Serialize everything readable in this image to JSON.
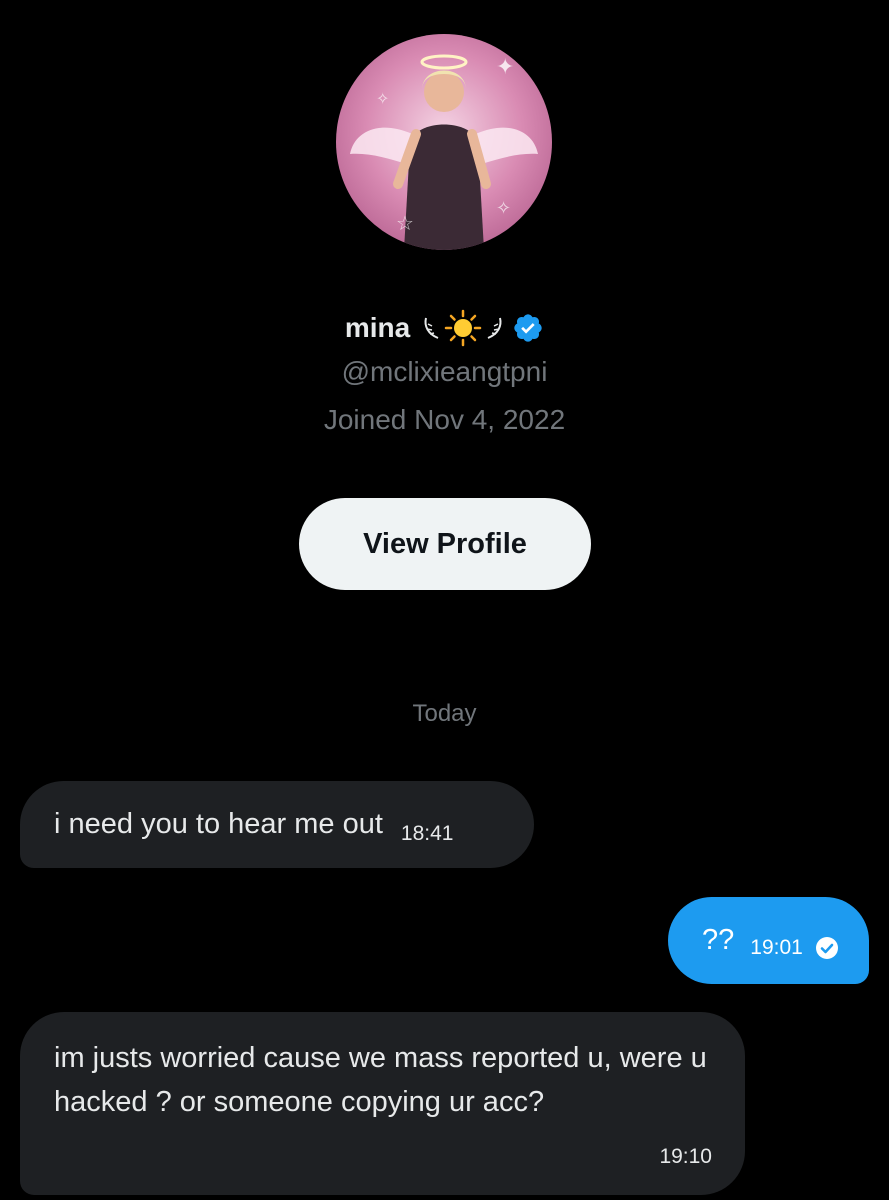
{
  "profile": {
    "display_name": "mina",
    "name_emoji": "☀️",
    "verified": true,
    "handle": "@mclixieangtpni",
    "joined": "Joined Nov 4, 2022",
    "view_profile_label": "View Profile"
  },
  "conversation": {
    "date_separator": "Today",
    "messages": [
      {
        "direction": "received",
        "text": "i need you to hear me out",
        "time": "18:41"
      },
      {
        "direction": "sent",
        "text": "??",
        "time": "19:01",
        "status": "read"
      },
      {
        "direction": "received",
        "text": "im justs worried cause we mass reported u, were u hacked ? or someone copying ur acc?",
        "time": "19:10"
      }
    ]
  },
  "colors": {
    "background": "#000000",
    "sent_bubble": "#1d9bf0",
    "received_bubble": "#1e2023",
    "verified_badge": "#1d9bf0",
    "muted_text": "#71767b"
  }
}
